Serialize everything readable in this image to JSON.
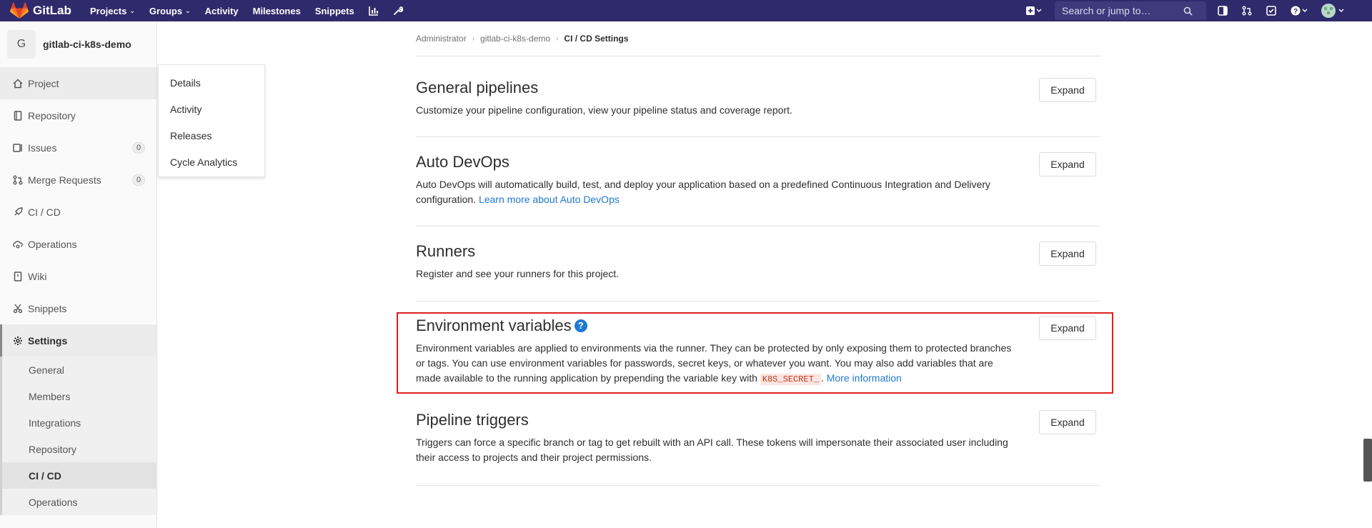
{
  "navbar": {
    "brand": "GitLab",
    "links": [
      {
        "label": "Projects",
        "dropdown": true
      },
      {
        "label": "Groups",
        "dropdown": true
      },
      {
        "label": "Activity",
        "dropdown": false
      },
      {
        "label": "Milestones",
        "dropdown": false
      },
      {
        "label": "Snippets",
        "dropdown": false
      }
    ],
    "search_placeholder": "Search or jump to…",
    "icons": [
      "chart-icon",
      "wrench-icon",
      "plus-icon",
      "sidebar-toggle-icon",
      "merge-request-icon",
      "todo-icon",
      "help-icon",
      "user-avatar"
    ]
  },
  "sidebar": {
    "project_initial": "G",
    "project_name": "gitlab-ci-k8s-demo",
    "items": [
      {
        "label": "Project",
        "icon": "home-icon"
      },
      {
        "label": "Repository",
        "icon": "book-icon"
      },
      {
        "label": "Issues",
        "icon": "issues-icon",
        "badge": "0"
      },
      {
        "label": "Merge Requests",
        "icon": "merge-request-icon",
        "badge": "0"
      },
      {
        "label": "CI / CD",
        "icon": "rocket-icon"
      },
      {
        "label": "Operations",
        "icon": "cloud-gear-icon"
      },
      {
        "label": "Wiki",
        "icon": "wiki-icon"
      },
      {
        "label": "Snippets",
        "icon": "scissors-icon"
      },
      {
        "label": "Settings",
        "icon": "gear-icon"
      }
    ],
    "settings_subitems": [
      "General",
      "Members",
      "Integrations",
      "Repository",
      "CI / CD",
      "Operations"
    ]
  },
  "flyout": {
    "items": [
      "Details",
      "Activity",
      "Releases",
      "Cycle Analytics"
    ]
  },
  "breadcrumb": {
    "items": [
      "Administrator",
      "gitlab-ci-k8s-demo",
      "CI / CD Settings"
    ]
  },
  "sections": {
    "general": {
      "title": "General pipelines",
      "description": "Customize your pipeline configuration, view your pipeline status and coverage report.",
      "button": "Expand"
    },
    "autodevops": {
      "title": "Auto DevOps",
      "description": "Auto DevOps will automatically build, test, and deploy your application based on a predefined Continuous Integration and Delivery configuration.",
      "link": "Learn more about Auto DevOps",
      "button": "Expand"
    },
    "runners": {
      "title": "Runners",
      "description": "Register and see your runners for this project.",
      "button": "Expand"
    },
    "envvars": {
      "title": "Environment variables",
      "description_before": "Environment variables are applied to environments via the runner. They can be protected by only exposing them to protected branches or tags. You can use environment variables for passwords, secret keys, or whatever you want. You may also add variables that are made available to the running application by prepending the variable key with",
      "code": "K8S_SECRET_",
      "description_after": ".",
      "link": "More information",
      "button": "Expand"
    },
    "triggers": {
      "title": "Pipeline triggers",
      "description": "Triggers can force a specific branch or tag to get rebuilt with an API call. These tokens will impersonate their associated user including their access to projects and their project permissions.",
      "button": "Expand"
    }
  },
  "colors": {
    "navbar": "#2f2a6b",
    "link": "#1f78d1",
    "highlight": "#e02020"
  }
}
